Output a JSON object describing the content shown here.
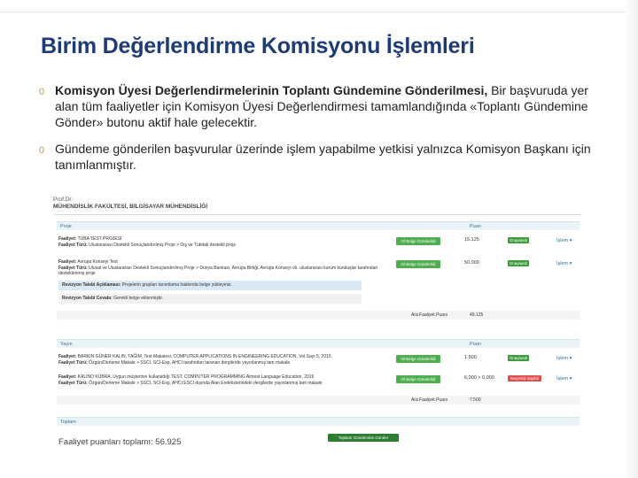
{
  "slide": {
    "title": "Birim Değerlendirme Komisyonu İşlemleri",
    "bullet_mark": "0",
    "bullets": [
      {
        "bold": "Komisyon Üyesi Değerlendirmelerinin Toplantı Gündemine Gönderilmesi,",
        "text": " Bir başvuruda yer alan tüm faaliyetler için Komisyon Üyesi Değerlendirmesi tamamlandığında «Toplantı Gündemine Gönder» butonu aktif hale gelecektir."
      },
      {
        "bold": "",
        "text": "Gündeme gönderilen başvurular üzerinde işlem yapabilme yetkisi yalnızca Komisyon Başkanı için tanımlanmıştır."
      }
    ]
  },
  "screenshot": {
    "person_title": "Prof.Dr.",
    "department": "MÜHENDİSLİK FAKÜLTESİ, BİLGİSAYAR MÜHENDİSLİĞİ",
    "section_proje": {
      "label": "Proje",
      "points_header": "Puan",
      "rows": [
        {
          "line1_label": "Faaliyet:",
          "line1_text": " TÜBA TEST PROJESİ",
          "line2_label": "Faaliyet Türü:",
          "line2_text": " Uluslararası Destekli Sonuçlandırılmış Proje > Dış ve Tübitak destekli proje",
          "button": "Ol Belge Gönderildi",
          "score": "15.125",
          "status": "Onaylandı",
          "action": "İşlem ▾"
        },
        {
          "line1_label": "Faaliyet:",
          "line1_text": " Avrupa Konseyi Test",
          "line2_label": "Faaliyet Türü:",
          "line2_text": " Ulusal ve Uluslararası Destekli Sonuçlandırılmış Proje > Dünya Bankası, Avrupa Birliği, Avrupa Konseyi vb. uluslararası kurum kuruluşlar tarafından desteklenmiş proje",
          "button": "Ol Belge Gönderildi",
          "score": "50.000",
          "status": "Onaylandı",
          "action": "İşlem ▾"
        }
      ],
      "revision_note_label": "Revizyon Talebi Açıklaması:",
      "revision_note_text": " Projelerin grupları tanımlama hakkında belge yükleyiniz.",
      "revision_answer_label": "Revizyon Talebi Cevabı:",
      "revision_answer_text": " Gerekli belge eklenmiştir.",
      "total_label": "Ara Faaliyet Puanı",
      "total_value": "49.125"
    },
    "section_yayin": {
      "label": "Yayın",
      "points_header": "Puan",
      "rows": [
        {
          "line1_label": "Faaliyet:",
          "line1_text": " BARKIN GÜNER KALIN, TAĞİM, Test Makalesi, COMPUTER APPLICATIONS IN ENGINEERING EDUCATION, Vol.Sayı 5, 2015",
          "line2_label": "Faaliyet Türü:",
          "line2_text": " Özgün/Derleme Makale > SSCI, SCI-Exp, AHCI tarafından taranan dergilerde yayınlanmış tam makale",
          "button": "Ol Belge Gönderildi",
          "score": "1.500",
          "status": "Onaylandı",
          "status_type": "green",
          "action": "İşlem ▾"
        },
        {
          "line1_label": "Faaliyet:",
          "line1_text": " KALINO KÜBRA, Uygun müşterinin kullanıldığı TEST, COMPUTER PROGRAMMING Almost Language Education, 2016",
          "line2_label": "Faaliyet Türü:",
          "line2_text": " Özgün/Derleme Makale > SSCI, SCI-Exp, AHCI ESCI dışında Alan Endekslerindeki dergilerde yayınlanmış tam makale",
          "button": "Ol Belge Gönderildi",
          "score": "6,000 > 0,000",
          "status": "Geçersiz sayıldı",
          "status_type": "red",
          "action": "İşlem ▾"
        }
      ],
      "total_label": "Ara Faaliyet Puanı",
      "total_value": "7.500"
    },
    "section_toplam": {
      "label": "Toplam"
    },
    "send_button": "Toplantı Gündemine Gönder",
    "grand_total": "Faaliyet puanları toplamı: 56.925",
    "colors": {
      "title": "#1f3b73",
      "button_green": "#4fae4f",
      "status_green": "#3d9a3d",
      "status_red": "#e05050",
      "section_bg": "#eaf3f8"
    }
  }
}
